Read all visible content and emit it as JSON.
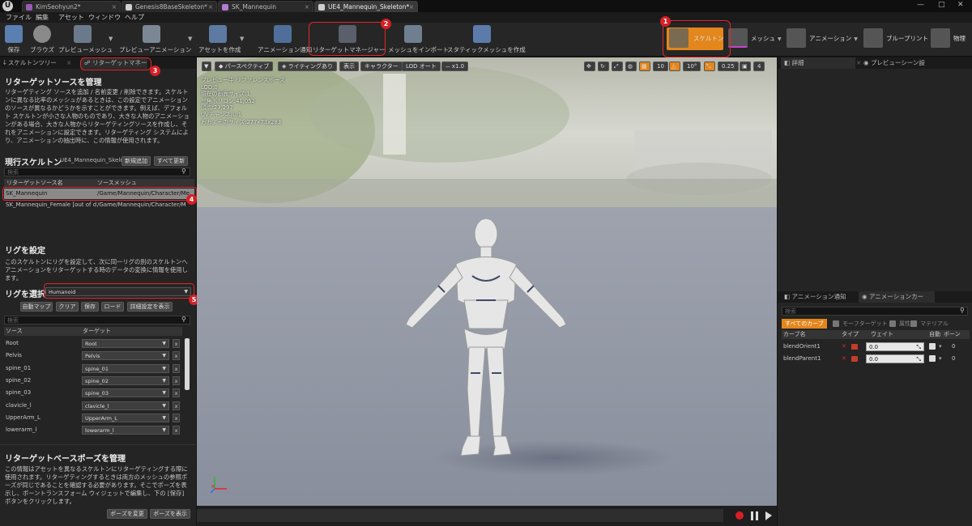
{
  "titlebar": {
    "tabs": [
      "KimSeohyun2*",
      "Genesis8BaseSkeleton*",
      "SK_Mannequin",
      "UE4_Mannequin_Skeleton*"
    ],
    "window_controls": [
      "minimize-icon",
      "maximize-icon",
      "close-icon"
    ]
  },
  "menubar": {
    "items": [
      "ファイル",
      "編集",
      "アセット",
      "ウィンドウ",
      "ヘルプ"
    ]
  },
  "toolbar": {
    "buttons": [
      "保存",
      "ブラウズ",
      "プレビューメッシュ",
      "プレビューアニメーション",
      "アセットを作成",
      "アニメーション通知",
      "リターゲットマネージャー",
      "メッシュをインポート",
      "スタティックメッシュを作成"
    ],
    "modes": [
      "スケルトン",
      "メッシュ",
      "アニメーション",
      "ブループリント",
      "物理"
    ]
  },
  "annotations": [
    "1",
    "2",
    "3",
    "4",
    "5"
  ],
  "left": {
    "tabs": [
      "スケルトンツリー",
      "リターゲットマネー"
    ],
    "source_title": "リターゲットソースを管理",
    "source_desc": "リターゲティング ソースを追加 / 名前変更 / 削除できます。スケルトンに異なる比率のメッシュがあるときは、この設定でアニメーションのソースが異なるかどうかを示すことができます。例えば、デフォルト スケルトンが小さな人物のものであり、大きな人物のアニメーションがある場合、大きな人物からリターゲティングソースを作成し、それをアニメーションに設定できます。リターゲティング システムにより、アニメーションの抽出時に、この情報が使用されます。",
    "current_skeleton_label": "現行スケルトン",
    "current_skeleton_value": "UE4_Mannequin_Skele",
    "add_new": "新規追加",
    "update_all": "すべて更新",
    "search_placeholder": "検索",
    "source_headers": [
      "リターゲットソース名",
      "ソースメッシュ"
    ],
    "sources": [
      {
        "name": "SK_Mannequin",
        "path": "/Game/Mannequin/Character/Me"
      },
      {
        "name": "SK_Mannequin_Female [out of dat",
        "path": "/Game/Mannequin/Character/M"
      }
    ],
    "rig_title": "リグを設定",
    "rig_desc": "このスケルトンにリグを設定して、次に同一リグの別のスケルトンへアニメーションをリターゲットする時のデータの変換に情報を使用します。",
    "rig_select_label": "リグを選択",
    "rig_value": "Humanoid",
    "rig_buttons": [
      "自動マップ",
      "クリア",
      "保存",
      "ロード",
      "詳細設定を表示"
    ],
    "mapping_headers": [
      "ソース",
      "ターゲット"
    ],
    "mapping": [
      {
        "source": "Root",
        "target": "Root"
      },
      {
        "source": "Pelvis",
        "target": "Pelvis"
      },
      {
        "source": "spine_01",
        "target": "spine_01"
      },
      {
        "source": "spine_02",
        "target": "spine_02"
      },
      {
        "source": "spine_03",
        "target": "spine_03"
      },
      {
        "source": "clavicle_l",
        "target": "clavicle_l"
      },
      {
        "source": "UpperArm_L",
        "target": "UpperArm_L"
      },
      {
        "source": "lowerarm_l",
        "target": "lowerarm_l"
      }
    ],
    "x_label": "x",
    "pose_title": "リターゲットベースポーズを管理",
    "pose_desc": "この情報はアセットを異なるスケルトンにリターゲティングする際に使用されます。リターゲティングするときは両方のメッシュの参照ポーズが同じであることを確認する必要があります。そこでポーズを表示し、ボーントランスフォーム ウィジェットで編集し、下の [保存] ボタンをクリックします。",
    "pose_buttons": [
      "ポーズを変更",
      "ポーズを表示"
    ]
  },
  "viewport": {
    "toolbar": [
      "パースペクティブ",
      "ライティングあり",
      "表示",
      "キャラクター",
      "LOD オート",
      "x1.0"
    ],
    "right_values": [
      "10",
      "10°",
      "0.25",
      "4"
    ],
    "stats": [
      "プレビュー中 リファレンスポーズ",
      "LOD:0",
      "現在の画面サイズ:1",
      "三角ポリゴン:41,052",
      "頂点:23,297",
      "UVチャンネル:1",
      "おおよそのサイズ:277x73x283"
    ]
  },
  "right": {
    "tabs": [
      "詳細",
      "プレビューシーン設"
    ],
    "bottom_tabs": [
      "アニメーション通知",
      "アニメーションカー"
    ],
    "search_placeholder": "検索",
    "filters": [
      "すべてのカーブ",
      "モーフターゲット",
      "属性",
      "マテリアル"
    ],
    "headers": [
      "カーブ名",
      "タイプ",
      "ウェイト",
      "自動",
      "ボーン"
    ],
    "curves": [
      {
        "name": "blendOrient1",
        "weight": "0.0",
        "bones": "0"
      },
      {
        "name": "blendParent1",
        "weight": "0.0",
        "bones": "0"
      }
    ]
  },
  "colors": {
    "accent": "#e3861c",
    "highlight_red": "#e5252a",
    "selected_row": "#8a8a8a"
  }
}
